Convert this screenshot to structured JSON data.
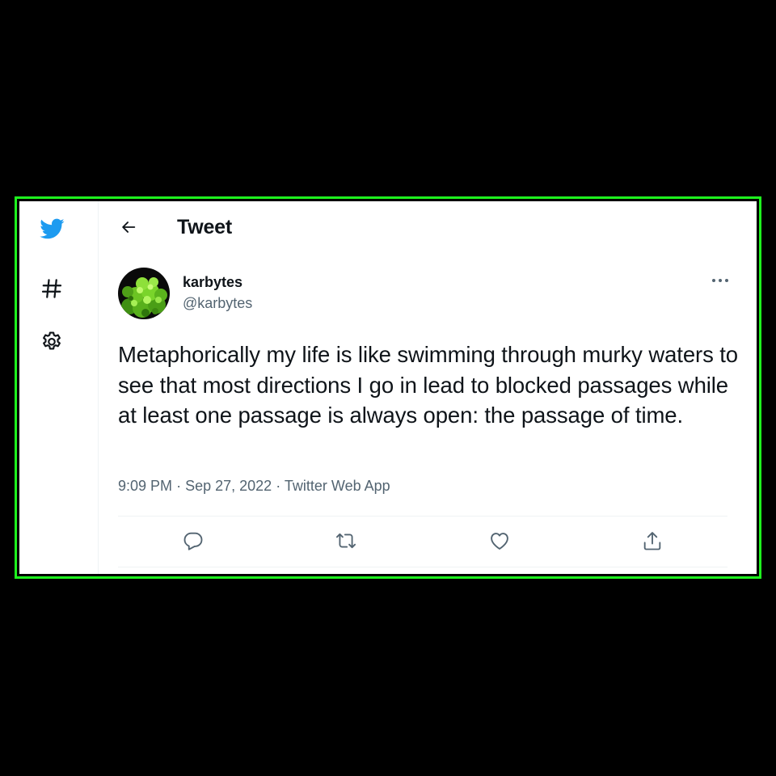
{
  "colors": {
    "accent": "#1d9bf0",
    "text_primary": "#0f1419",
    "text_secondary": "#536471",
    "frame_border": "#1ef51e",
    "divider": "#eff3f4"
  },
  "sidebar": {
    "icons": [
      "twitter-bird-logo",
      "hashtag-explore",
      "settings-gear"
    ]
  },
  "header": {
    "back_icon": "arrow-left",
    "title": "Tweet"
  },
  "tweet": {
    "author": {
      "display_name": "karbytes",
      "handle": "@karbytes",
      "avatar": "green-foliage-image"
    },
    "more_icon": "more-horizontal",
    "text": "Metaphorically my life is like swimming through murky waters to see that most directions I go in lead to blocked passages while at least one passage is always open: the passage of time.",
    "time": "9:09 PM",
    "date": "Sep 27, 2022",
    "source": "Twitter Web App",
    "separator": "·",
    "actions": [
      "reply",
      "retweet",
      "like",
      "share"
    ]
  }
}
